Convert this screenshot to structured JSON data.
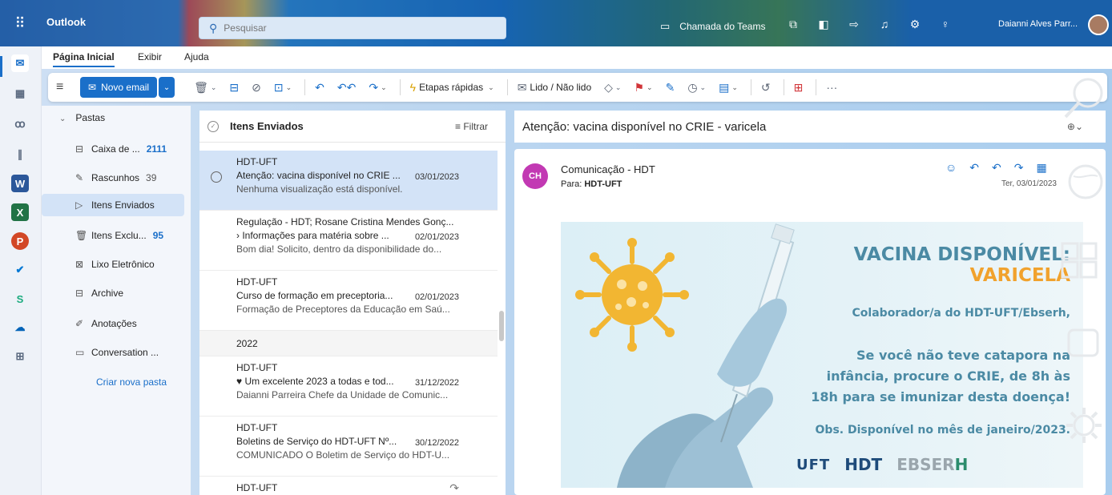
{
  "app": {
    "title": "Outlook"
  },
  "search": {
    "placeholder": "Pesquisar"
  },
  "topbar": {
    "teams_label": "Chamada do Teams",
    "user_name": "Daianni Alves Parr..."
  },
  "ribbon": {
    "tabs": [
      "Página Inicial",
      "Exibir",
      "Ajuda"
    ],
    "new_mail": "Novo email",
    "quick_steps": "Etapas rápidas",
    "read_unread": "Lido / Não lido",
    "more": "···"
  },
  "folders": {
    "header": "Pastas",
    "items": [
      {
        "label": "Caixa de ...",
        "count": "2111"
      },
      {
        "label": "Rascunhos",
        "count": "39"
      },
      {
        "label": "Itens Enviados",
        "count": ""
      },
      {
        "label": "Itens Exclu...",
        "count": "95"
      },
      {
        "label": "Lixo Eletrônico",
        "count": ""
      },
      {
        "label": "Archive",
        "count": ""
      },
      {
        "label": "Anotações",
        "count": ""
      },
      {
        "label": "Conversation ...",
        "count": ""
      }
    ],
    "new_folder": "Criar nova pasta"
  },
  "list": {
    "title": "Itens Enviados",
    "filter": "Filtrar",
    "group": "2022",
    "messages": [
      {
        "from": "HDT-UFT",
        "subject": "Atenção: vacina disponível no CRIE ...",
        "date": "03/01/2023",
        "preview": "Nenhuma visualização está disponível."
      },
      {
        "from": "Regulação - HDT; Rosane Cristina Mendes Gonç...",
        "subject": "› Informações para matéria sobre ...",
        "date": "02/01/2023",
        "preview": "Bom dia! Solicito, dentro da disponibilidade do..."
      },
      {
        "from": "HDT-UFT",
        "subject": "Curso de formação em preceptoria...",
        "date": "02/01/2023",
        "preview": "Formação de Preceptores da Educação em Saú..."
      },
      {
        "from": "HDT-UFT",
        "subject": "♥ Um excelente 2023 a todas e tod...",
        "date": "31/12/2022",
        "preview": "Daianni Parreira Chefe da Unidade de Comunic..."
      },
      {
        "from": "HDT-UFT",
        "subject": "Boletins de Serviço do HDT-UFT Nº...",
        "date": "30/12/2022",
        "preview": "COMUNICADO O Boletim de Serviço do HDT-U..."
      },
      {
        "from": "HDT-UFT",
        "subject": "",
        "date": "",
        "preview": ""
      }
    ]
  },
  "reading": {
    "subject": "Atenção: vacina disponível no CRIE - varicela",
    "sender_initials": "CH",
    "sender": "Comunicação - HDT",
    "to_label": "Para:",
    "to": "HDT-UFT",
    "date": "Ter, 03/01/2023"
  },
  "banner": {
    "line1": "VACINA DISPONÍVEL:",
    "line2": "VARICELA",
    "line3": "Colaborador/a do HDT-UFT/Ebserh,",
    "line4a": "Se você não teve catapora na",
    "line4b": "infância, procure o CRIE, de 8h às",
    "line4c": "18h para se imunizar desta doença!",
    "line5": "Obs. Disponível no mês de janeiro/2023.",
    "logo_uft": "UFT",
    "logo_hdt": "HDT",
    "logo_ebserh_a": "EBSER",
    "logo_ebserh_b": "H"
  },
  "colors": {
    "accent": "#1a6fc9",
    "selected": "#d3e3f7",
    "banner_blue": "#4b8aa4",
    "banner_orange": "#f1a22d",
    "sender_avatar": "#c239b3"
  }
}
